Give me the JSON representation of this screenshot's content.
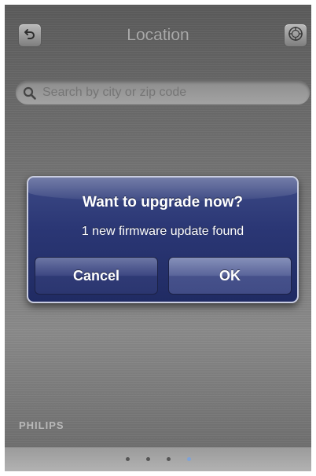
{
  "header": {
    "title": "Location",
    "back_icon": "back-arrow-icon",
    "right_icon": "compass-icon"
  },
  "search": {
    "placeholder": "Search by city or zip code",
    "icon": "search-icon"
  },
  "dialog": {
    "title": "Want to upgrade now?",
    "message": "1 new firmware update found",
    "cancel_label": "Cancel",
    "ok_label": "OK"
  },
  "brand": {
    "text": "PHILIPS"
  },
  "pager": {
    "page_count": 4,
    "active_page": 4
  },
  "colors": {
    "dialog_blue": "#2b3775",
    "active_dot": "#7fa3d8"
  }
}
